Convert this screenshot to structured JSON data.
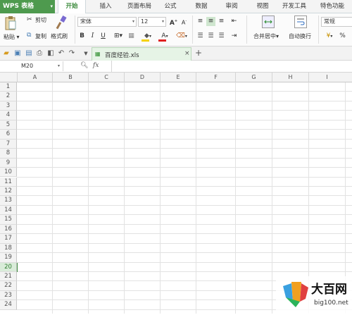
{
  "app": {
    "name": "WPS 表格",
    "arrow": "▾"
  },
  "tabs": [
    "开始",
    "插入",
    "页面布局",
    "公式",
    "数据",
    "审阅",
    "视图",
    "开发工具",
    "特色功能"
  ],
  "ribbon": {
    "paste": "粘贴",
    "cut": "剪切",
    "copy": "复制",
    "format_painter": "格式刷",
    "font_name": "宋体",
    "font_size": "12",
    "merge_center": "合并居中",
    "wrap_text": "自动换行",
    "number_format": "常规",
    "bold": "B",
    "italic": "I",
    "underline": "U",
    "grow_font": "A",
    "shrink_font": "A",
    "font_color": "A",
    "percent": "%"
  },
  "document_tab": {
    "title": "百度经验.xls",
    "close": "×",
    "new": "+"
  },
  "formula_bar": {
    "cell_ref": "M20",
    "fx": "fx"
  },
  "columns": [
    "A",
    "B",
    "C",
    "D",
    "E",
    "F",
    "G",
    "H",
    "I"
  ],
  "rows": [
    "1",
    "2",
    "3",
    "4",
    "5",
    "6",
    "7",
    "8",
    "9",
    "10",
    "11",
    "12",
    "13",
    "14",
    "15",
    "16",
    "17",
    "18",
    "19",
    "20",
    "21",
    "22",
    "23",
    "24"
  ],
  "selected_row": "20",
  "watermark": {
    "name": "大百网",
    "url": "big100.net"
  },
  "colors": {
    "accent": "#4e9a4e",
    "active_tab": "#3b8a3b"
  }
}
